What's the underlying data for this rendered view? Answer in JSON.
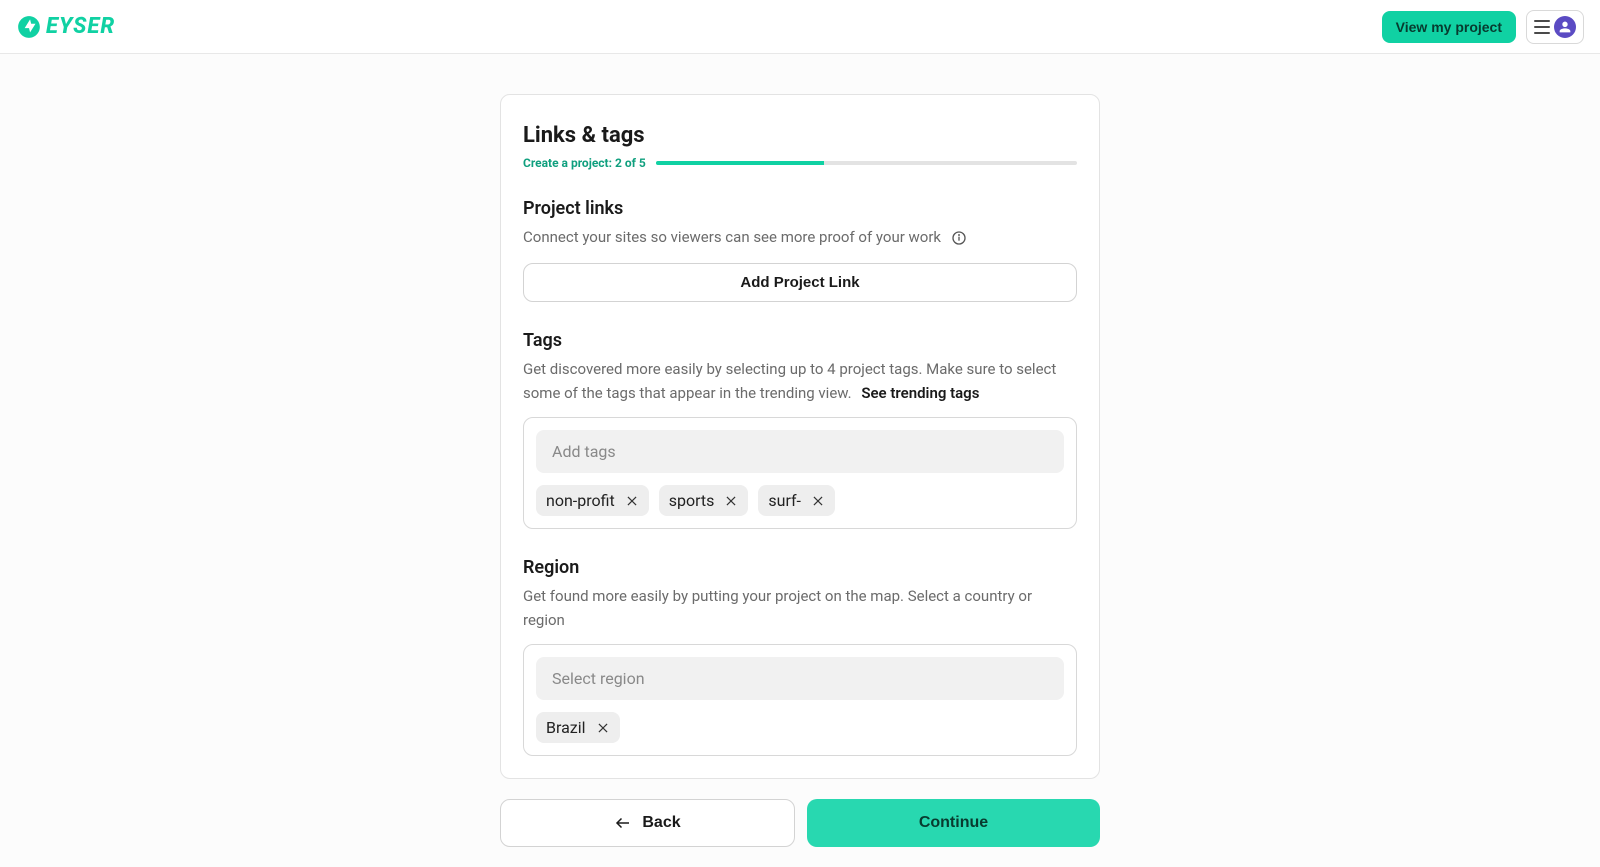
{
  "header": {
    "brand": "EYSER",
    "view_project": "View my project"
  },
  "card": {
    "title": "Links & tags",
    "progress_label": "Create a project: 2 of 5",
    "progress_percent": 40,
    "links": {
      "heading": "Project links",
      "desc": "Connect your sites so viewers can see more proof of your work",
      "add_btn": "Add Project Link"
    },
    "tags": {
      "heading": "Tags",
      "desc": "Get discovered more easily by selecting up to 4 project tags. Make sure to select some of the tags that appear in the trending view.",
      "trending_link": "See trending tags",
      "placeholder": "Add tags",
      "items": [
        "non-profit",
        "sports",
        "surf-"
      ]
    },
    "region": {
      "heading": "Region",
      "desc": "Get found more easily by putting your project on the map. Select a country or region",
      "placeholder": "Select region",
      "items": [
        "Brazil"
      ]
    }
  },
  "footer": {
    "back": "Back",
    "continue": "Continue"
  }
}
